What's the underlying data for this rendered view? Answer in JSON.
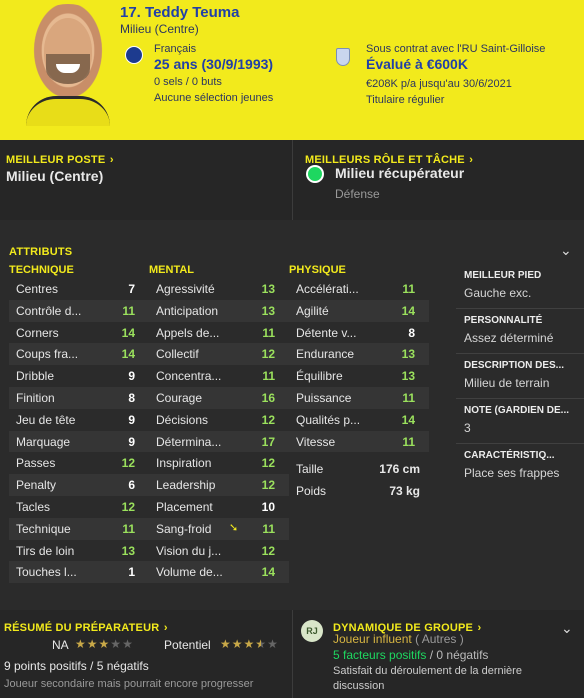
{
  "header": {
    "name": "17. Teddy Teuma",
    "role": "Milieu (Centre)",
    "nationality": "Français",
    "age": "25 ans (30/9/1993)",
    "caps": "0 sels / 0 buts",
    "youth": "Aucune sélection jeunes",
    "contract": "Sous contrat avec l'RU Saint-Gilloise",
    "value": "Évalué à €600K",
    "wage": "€208K p/a jusqu'au 30/6/2021",
    "status": "Titulaire régulier"
  },
  "best_position": {
    "title": "MEILLEUR POSTE",
    "value": "Milieu (Centre)"
  },
  "best_role": {
    "title": "MEILLEURS RÔLE ET TÂCHE",
    "role": "Milieu récupérateur",
    "duty": "Défense"
  },
  "attributes": {
    "title": "ATTRIBUTS",
    "technical": {
      "header": "TECHNIQUE",
      "rows": [
        {
          "label": "Centres",
          "value": "7"
        },
        {
          "label": "Contrôle d...",
          "value": "11"
        },
        {
          "label": "Corners",
          "value": "14"
        },
        {
          "label": "Coups fra...",
          "value": "14"
        },
        {
          "label": "Dribble",
          "value": "9"
        },
        {
          "label": "Finition",
          "value": "8"
        },
        {
          "label": "Jeu de tête",
          "value": "9"
        },
        {
          "label": "Marquage",
          "value": "9"
        },
        {
          "label": "Passes",
          "value": "12"
        },
        {
          "label": "Penalty",
          "value": "6"
        },
        {
          "label": "Tacles",
          "value": "12"
        },
        {
          "label": "Technique",
          "value": "11"
        },
        {
          "label": "Tirs de loin",
          "value": "13"
        },
        {
          "label": "Touches l...",
          "value": "1"
        }
      ]
    },
    "mental": {
      "header": "MENTAL",
      "rows": [
        {
          "label": "Agressivité",
          "value": "13"
        },
        {
          "label": "Anticipation",
          "value": "13"
        },
        {
          "label": "Appels de...",
          "value": "11"
        },
        {
          "label": "Collectif",
          "value": "12"
        },
        {
          "label": "Concentra...",
          "value": "11"
        },
        {
          "label": "Courage",
          "value": "16"
        },
        {
          "label": "Décisions",
          "value": "12"
        },
        {
          "label": "Détermina...",
          "value": "17"
        },
        {
          "label": "Inspiration",
          "value": "12"
        },
        {
          "label": "Leadership",
          "value": "12"
        },
        {
          "label": "Placement",
          "value": "10"
        },
        {
          "label": "Sang-froid",
          "value": "11"
        },
        {
          "label": "Vision du j...",
          "value": "12"
        },
        {
          "label": "Volume de...",
          "value": "14"
        }
      ]
    },
    "physical": {
      "header": "PHYSIQUE",
      "rows": [
        {
          "label": "Accélérati...",
          "value": "11"
        },
        {
          "label": "Agilité",
          "value": "14"
        },
        {
          "label": "Détente v...",
          "value": "8"
        },
        {
          "label": "Endurance",
          "value": "13"
        },
        {
          "label": "Équilibre",
          "value": "13"
        },
        {
          "label": "Puissance",
          "value": "11"
        },
        {
          "label": "Qualités p...",
          "value": "14"
        },
        {
          "label": "Vitesse",
          "value": "11"
        }
      ],
      "height_label": "Taille",
      "height": "176 cm",
      "weight_label": "Poids",
      "weight": "73 kg"
    },
    "side": [
      {
        "key": "MEILLEUR PIED",
        "value": "Gauche exc."
      },
      {
        "key": "PERSONNALITÉ",
        "value": "Assez déterminé"
      },
      {
        "key": "DESCRIPTION DES...",
        "value": "Milieu de terrain"
      },
      {
        "key": "NOTE (GARDIEN DE...",
        "value": "3"
      },
      {
        "key": "CARACTÉRISTIQ...",
        "value": "Place ses frappes"
      }
    ]
  },
  "coach": {
    "title": "RÉSUMÉ DU PRÉPARATEUR",
    "na_label": "NA",
    "na_stars": 3,
    "potential_label": "Potentiel",
    "potential_stars": 3.5,
    "points": "9 points positifs / 5 négatifs",
    "summary": "Joueur secondaire mais pourrait encore progresser"
  },
  "dynamics": {
    "title": "DYNAMIQUE DE GROUPE",
    "badge": "RJ",
    "influence": "Joueur influent",
    "group": "( Autres )",
    "positives": "5 facteurs positifs",
    "negatives": "/ 0 négatifs",
    "satisfaction": "Satisfait du déroulement de la dernière discussion"
  },
  "colors": {
    "accent": "#f2ea1c",
    "value_green": "#9be15d",
    "value_white": "#ffffff",
    "header_blue": "#2140a8"
  }
}
